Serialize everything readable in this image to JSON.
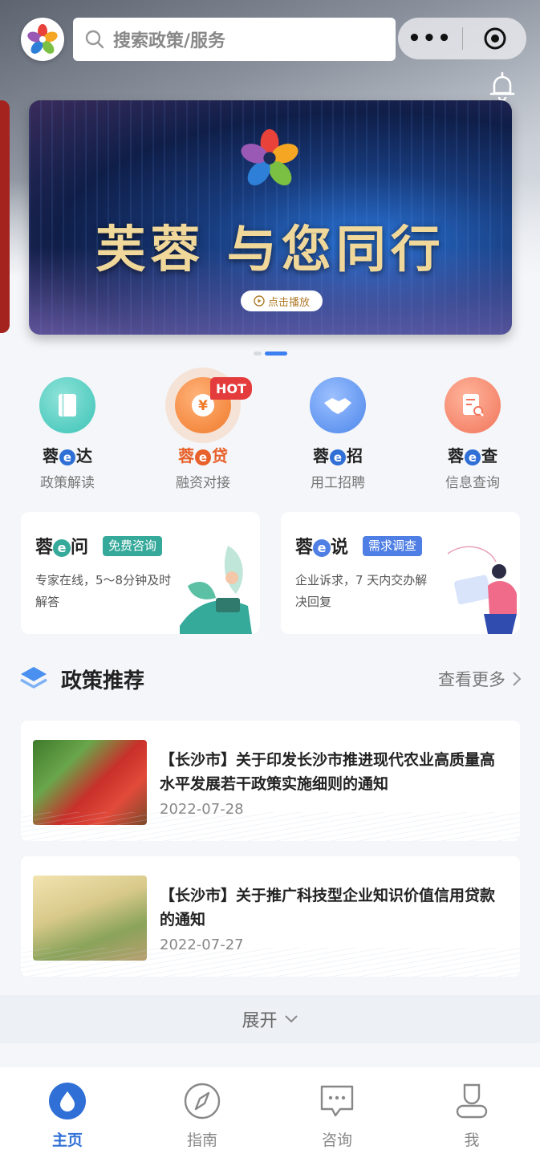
{
  "header": {
    "search_placeholder": "搜索政策/服务",
    "capsule_more": "•••"
  },
  "banner": {
    "slogan": "芙蓉 与您同行",
    "play_label": "点击播放"
  },
  "quick_entries": [
    {
      "prefix": "蓉",
      "e": "e",
      "suffix": "达",
      "sub": "政策解读",
      "icon": "book-icon",
      "color": "#3cc3b6"
    },
    {
      "prefix": "蓉",
      "e": "e",
      "suffix": "贷",
      "sub": "融资对接",
      "icon": "yuan-coin-icon",
      "color": "#f07a2a",
      "badge": "HOT"
    },
    {
      "prefix": "蓉",
      "e": "e",
      "suffix": "招",
      "sub": "用工招聘",
      "icon": "handshake-icon",
      "color": "#4c86ea"
    },
    {
      "prefix": "蓉",
      "e": "e",
      "suffix": "查",
      "sub": "信息查询",
      "icon": "document-search-icon",
      "color": "#f0745a"
    }
  ],
  "services": [
    {
      "prefix": "蓉",
      "e": "e",
      "suffix": "问",
      "tag": "免费咨询",
      "desc": "专家在线，5～8分钟及时解答",
      "tag_color": "#35a99a",
      "e_color": "#35a99a"
    },
    {
      "prefix": "蓉",
      "e": "e",
      "suffix": "说",
      "tag": "需求调查",
      "desc": "企业诉求，7 天内交办解决回复",
      "tag_color": "#4f7fe4",
      "e_color": "#4f7fe4"
    }
  ],
  "policy": {
    "title": "政策推荐",
    "more": "查看更多",
    "items": [
      {
        "title": "【长沙市】关于印发长沙市推进现代农业高质量高水平发展若干政策实施细则的通知",
        "date": "2022-07-28",
        "image": "vegetables-photo"
      },
      {
        "title": "【长沙市】关于推广科技型企业知识价值信用贷款的通知",
        "date": "2022-07-27",
        "image": "coins-plant-photo"
      }
    ],
    "expand": "展开"
  },
  "tabbar": [
    {
      "label": "主页",
      "icon": "home-drop-icon",
      "active": true
    },
    {
      "label": "指南",
      "icon": "compass-icon",
      "active": false
    },
    {
      "label": "咨询",
      "icon": "chat-bubble-icon",
      "active": false
    },
    {
      "label": "我",
      "icon": "user-icon",
      "active": false
    }
  ],
  "colors": {
    "accent": "#2f6fd6",
    "hot": "#e43c3c"
  }
}
